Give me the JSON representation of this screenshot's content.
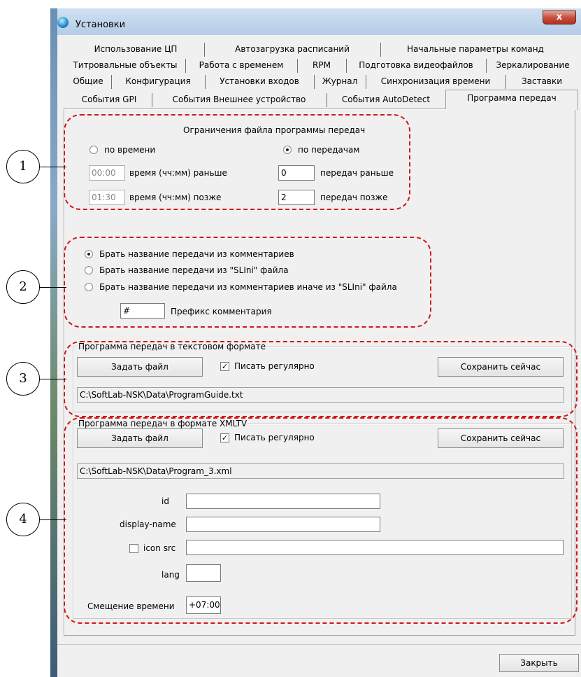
{
  "window": {
    "title": "Установки",
    "close_glyph": "x",
    "icon": "globe-icon"
  },
  "tabs": {
    "row1": [
      "Использование ЦП",
      "Автозагрузка расписаний",
      "Начальные параметры команд"
    ],
    "row2": [
      "Титровальные объекты",
      "Работа с временем",
      "RPM",
      "Подготовка видеофайлов",
      "Зеркалирование"
    ],
    "row3": [
      "Общие",
      "Конфигурация",
      "Установки входов",
      "Журнал",
      "Синхронизация времени",
      "Заставки"
    ],
    "row4": [
      "События GPI",
      "События Внешнее устройство",
      "События AutoDetect",
      "Программа передач"
    ],
    "active": "Программа передач"
  },
  "limits": {
    "caption": "Ограничения файла программы передач",
    "by_time_label": "по времени",
    "by_programs_label": "по передачам",
    "time_before_value": "00:00",
    "time_before_label": "время (чч:мм) раньше",
    "time_after_value": "01:30",
    "time_after_label": "время (чч:мм) позже",
    "programs_before_value": "0",
    "programs_before_label": "передач раньше",
    "programs_after_value": "2",
    "programs_after_label": "передач позже",
    "selected": "по передачам"
  },
  "name_source": {
    "option1": "Брать название передачи из комментариев",
    "option2": "Брать название передачи из \"SLIni\" файла",
    "option3": "Брать название передачи из комментариев иначе из \"SLIni\" файла",
    "selected": "Брать название передачи из комментариев",
    "prefix_value": "#",
    "prefix_label": "Префикс комментария"
  },
  "text_format": {
    "caption": "Программа передач в текстовом формате",
    "set_file_label": "Задать файл",
    "write_regularly_label": "Писать регулярно",
    "write_regularly_checked": true,
    "save_now_label": "Сохранить сейчас",
    "path": "C:\\SoftLab-NSK\\Data\\ProgramGuide.txt"
  },
  "xmltv": {
    "caption": "Программа передач в формате XMLTV",
    "set_file_label": "Задать файл",
    "write_regularly_label": "Писать регулярно",
    "write_regularly_checked": true,
    "save_now_label": "Сохранить сейчас",
    "path": "C:\\SoftLab-NSK\\Data\\Program_3.xml",
    "id_label": "id",
    "id_value": "",
    "display_name_label": "display-name",
    "display_name_value": "",
    "icon_src_label": "icon src",
    "icon_src_checked": false,
    "icon_src_value": "",
    "lang_label": "lang",
    "lang_value": "",
    "time_offset_label": "Смещение времени",
    "time_offset_value": "+07:00"
  },
  "footer": {
    "close_label": "Закрыть"
  },
  "callouts": [
    "1",
    "2",
    "3",
    "4"
  ],
  "colors": {
    "annotation_red": "#d01818",
    "window_frame": "#b9d1ea",
    "panel_bg": "#f0f0f0"
  }
}
